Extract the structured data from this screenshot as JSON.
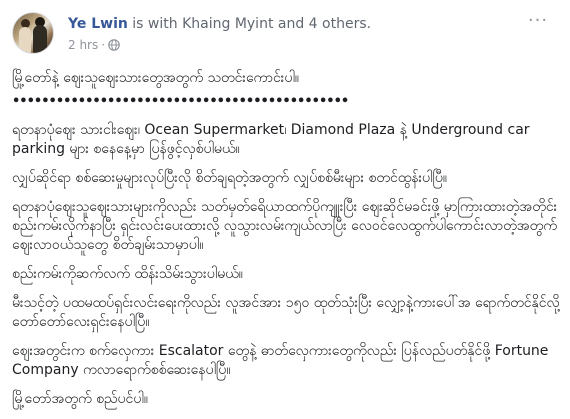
{
  "post": {
    "author": "Ye Lwin",
    "with_text": " is with Khaing Myint and 4 others.",
    "time": "2 hrs",
    "privacy_icon": "globe-icon",
    "menu_icon": "more-options-icon",
    "menu_label": "···",
    "paragraphs": [
      "မြို့တော်နဲ့ ဈေးသူဈေးသားတွေအတွက် သတင်းကောင်းပါ။",
      "••••••••••••••••••••••••••••••••••••••••••••••",
      "ရတနာပုံဈေး သားငါးဈေး၊ Ocean Supermarket၊ Diamond Plaza နဲ့ Underground car parking များ စနေနေ့မှာ ပြန်ဖွင့်လှစ်ပါမယ်။",
      "လျှပ်ဆိုင်ရာ စစ်ဆေးမှုများလုပ်ပြီးလို စိတ်ချရတဲ့အတွက် လျှပ်စစ်မီးများ စတင်ထွန်းပါပြီ။",
      "ရတနာပုံဈေးသူဈေးသားများကိုလည်း သတ်မှတ်ရေိယာထက်ပိုကျူးပြီး ဈေးဆိုင်မခင်းဖို့ မှာကြားထားတဲ့အတိုင်း စည်းကမ်းလိုက်နာပြီး ရှင်းလင်းပေးထားလို့ လူသွားလမ်းကျယ်လာပြီး လေဝင်လေထွက်ပါကောင်းလာတဲ့အတွက် ဈေးလာဝယ်သူတွေ စိတ်ချမ်းသာမှာပါ။",
      "စည်းကမ်းကိုဆက်လက် ထိန်းသိမ်းသွားပါမယ်။",
      "မီးသင့်တဲ့ ပထမထပ်ရှင်းလင်းရေးကိုလည်း လူအင်အား ၁၅ဝ ထုတ်သုံးပြီး လျှော့နဲ့ကားပေါ်အ ရောက်တင်နိုင်လို့ တော်တော်လေးရှင်းနေပါပြီ။",
      "ဈေးအတွင်းက စက်လှေကား Escalator တွေနဲ့ ဓာတ်လှေကားတွေကိုလည်း ပြန်လည်ပတ်နိုင်ဖို့ Fortune Company ကလာရောက်စစ်ဆေးနေပါပြီ။",
      "မြို့တော်အတွက် စည်ပင်ပါ။"
    ]
  }
}
